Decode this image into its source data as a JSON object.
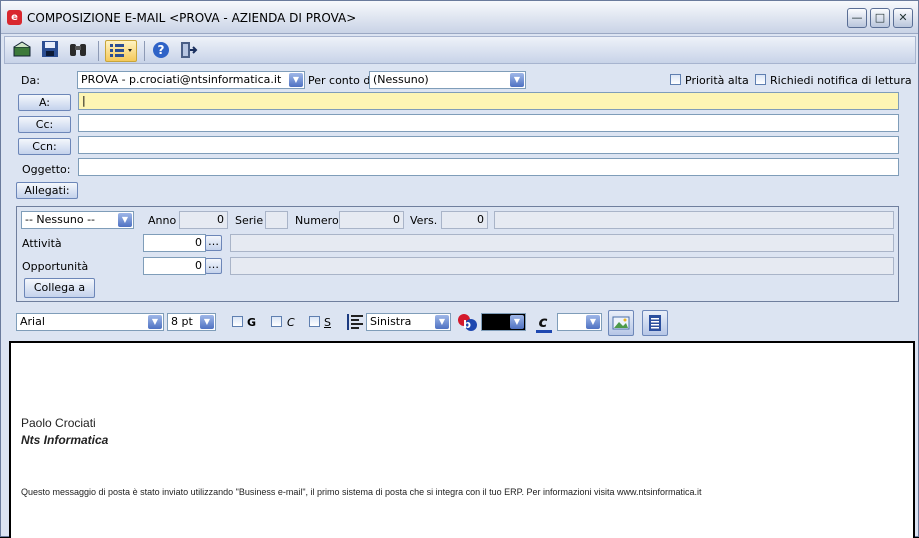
{
  "window": {
    "title": "COMPOSIZIONE E-MAIL <PROVA - AZIENDA DI PROVA>"
  },
  "header": {
    "da_label": "Da:",
    "da_value": "PROVA - p.crociati@ntsinformatica.it",
    "per_conto_label": "Per conto di",
    "per_conto_value": "(Nessuno)",
    "priorita_label": "Priorità alta",
    "notifica_label": "Richiedi notifica di lettura",
    "a_button": "A:",
    "a_value": "|",
    "cc_button": "Cc:",
    "cc_value": "",
    "ccn_button": "Ccn:",
    "ccn_value": "",
    "oggetto_label": "Oggetto:",
    "oggetto_value": "",
    "allegati_button": "Allegati:"
  },
  "panel": {
    "tipo_value": "-- Nessuno --",
    "anno_label": "Anno",
    "anno_value": "0",
    "serie_label": "Serie",
    "serie_value": "",
    "numero_label": "Numero",
    "numero_value": "0",
    "vers_label": "Vers.",
    "vers_value": "0",
    "attivita_label": "Attività",
    "attivita_value": "0",
    "opportunita_label": "Opportunità",
    "opportunita_value": "0",
    "collega_button": "Collega a"
  },
  "format": {
    "font_value": "Arial",
    "size_value": "8 pt",
    "bold_label": "G",
    "italic_label": "C",
    "underline_label": "S",
    "align_value": "Sinistra"
  },
  "body": {
    "sig_name": "Paolo Crociati",
    "sig_company": "Nts Informatica",
    "footer_text": "Questo messaggio di posta è stato inviato utilizzando \"Business e-mail\", il primo sistema di posta che si integra con il tuo ERP. Per informazioni visita www.ntsinformatica.it"
  },
  "colors": {
    "accent": "#3a6fd0",
    "required_field": "#fdf5b4",
    "fore_color": "#000000"
  }
}
